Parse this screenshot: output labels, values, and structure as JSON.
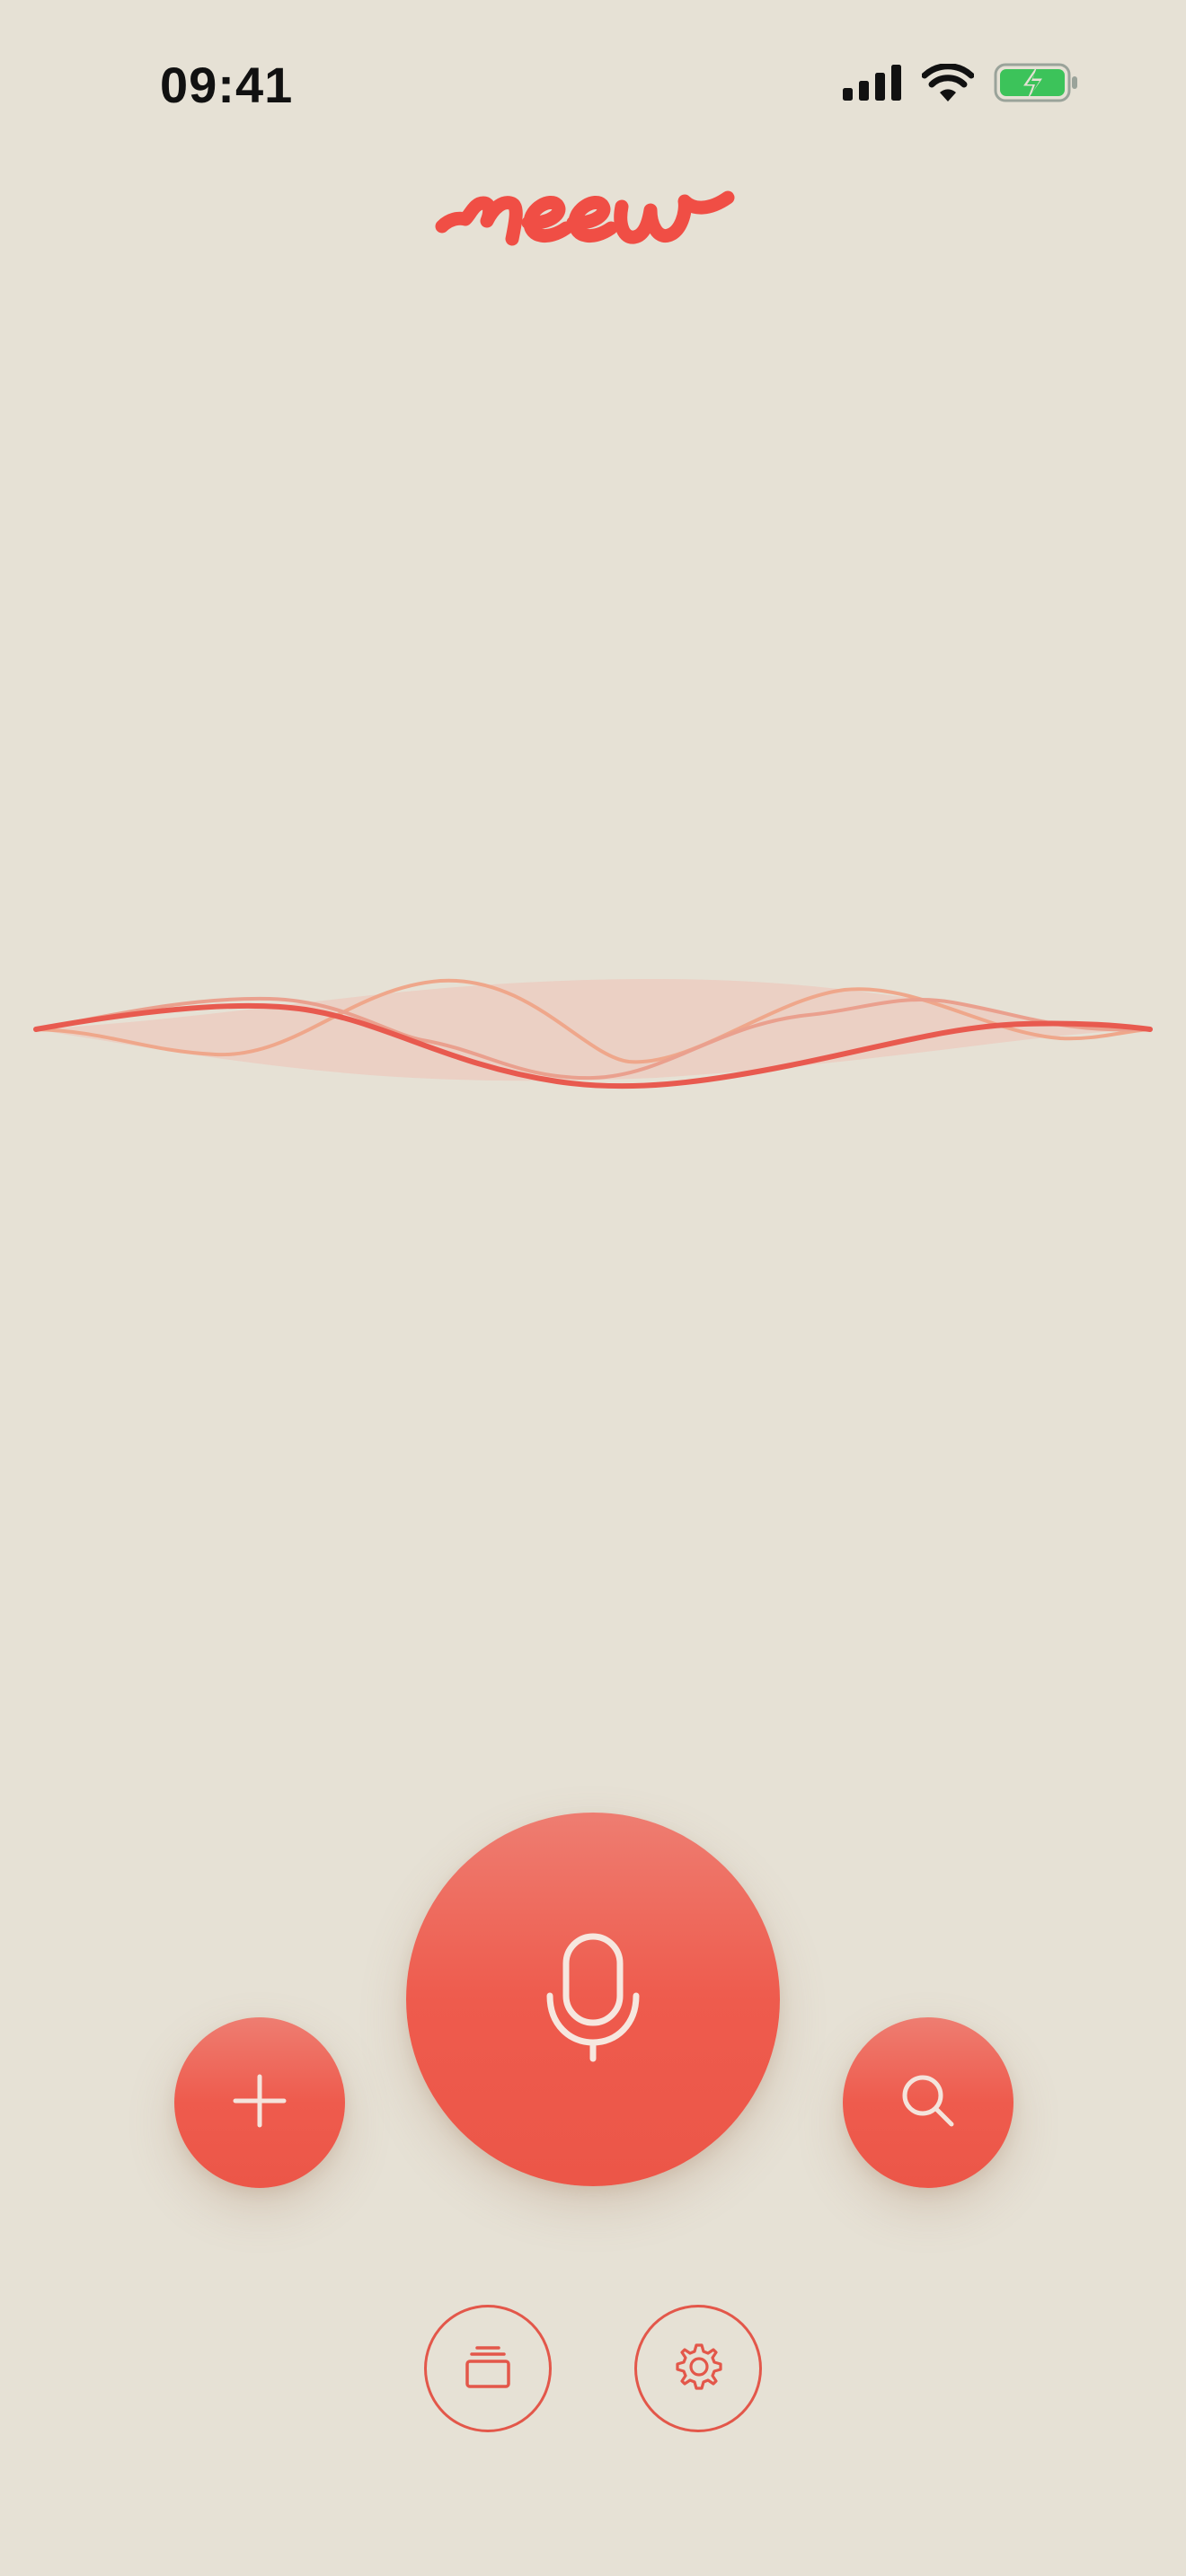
{
  "status_bar": {
    "time": "09:41",
    "icons": [
      "cellular-signal-icon",
      "wifi-icon",
      "battery-charging-icon"
    ]
  },
  "app": {
    "logo_text": "meew",
    "brand_color": "#f04e45",
    "background_color": "#e6e1d5"
  },
  "waveform": {
    "colors": [
      "#e85a4f",
      "#efa78b",
      "#eaa08e",
      "#ecc9bd"
    ]
  },
  "controls": {
    "mic": {
      "icon": "microphone-icon"
    },
    "add": {
      "icon": "plus-icon"
    },
    "search": {
      "icon": "search-icon"
    },
    "library": {
      "icon": "stack-icon"
    },
    "settings": {
      "icon": "gear-icon"
    }
  }
}
